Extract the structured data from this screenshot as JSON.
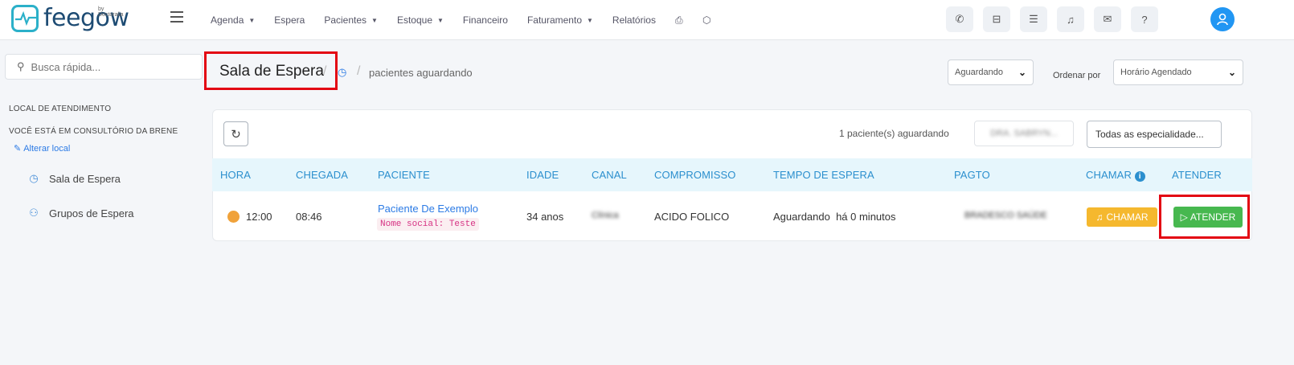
{
  "logo": {
    "text": "feegow",
    "by": "by Doctoralia"
  },
  "nav": [
    {
      "label": "Agenda",
      "dropdown": true
    },
    {
      "label": "Espera",
      "dropdown": false
    },
    {
      "label": "Pacientes",
      "dropdown": true
    },
    {
      "label": "Estoque",
      "dropdown": true
    },
    {
      "label": "Financeiro",
      "dropdown": false
    },
    {
      "label": "Faturamento",
      "dropdown": true
    },
    {
      "label": "Relatórios",
      "dropdown": false
    }
  ],
  "search": {
    "placeholder": "Busca rápida..."
  },
  "sidebar": {
    "section_title": "LOCAL DE ATENDIMENTO",
    "current_location": "VOCÊ ESTÁ EM CONSULTÓRIO DA BRENE",
    "change_location": "Alterar local",
    "items": [
      {
        "label": "Sala de Espera",
        "icon": "clock-icon"
      },
      {
        "label": "Grupos de Espera",
        "icon": "users-icon"
      }
    ]
  },
  "header": {
    "title": "Sala de Espera",
    "breadcrumb": "pacientes aguardando",
    "status_filter": "Aguardando",
    "order_label": "Ordenar por",
    "order_value": "Horário Agendado"
  },
  "toolbar": {
    "waiting_count": "1 paciente(s) aguardando",
    "doctor": "DRA. SABRYN...",
    "specialty": "Todas as especialidade..."
  },
  "table": {
    "columns": [
      "HORA",
      "CHEGADA",
      "PACIENTE",
      "IDADE",
      "CANAL",
      "COMPROMISSO",
      "TEMPO DE ESPERA",
      "PAGTO",
      "CHAMAR",
      "ATENDER"
    ],
    "rows": [
      {
        "hora": "12:00",
        "chegada": "08:46",
        "paciente": "Paciente De Exemplo",
        "nome_social": "Nome social: Teste",
        "idade": "34 anos",
        "canal": "Clínica",
        "compromisso": "ACIDO FOLICO",
        "tempo": "Aguardando  há 0 minutos",
        "pagto": "BRADESCO SAÚDE",
        "chamar_label": "CHAMAR",
        "atender_label": "ATENDER"
      }
    ]
  },
  "colors": {
    "primary": "#2c7be5",
    "header_bg": "#e6f6fc",
    "chamar": "#f5b82e",
    "atender": "#47b84f",
    "highlight": "#e30613"
  }
}
